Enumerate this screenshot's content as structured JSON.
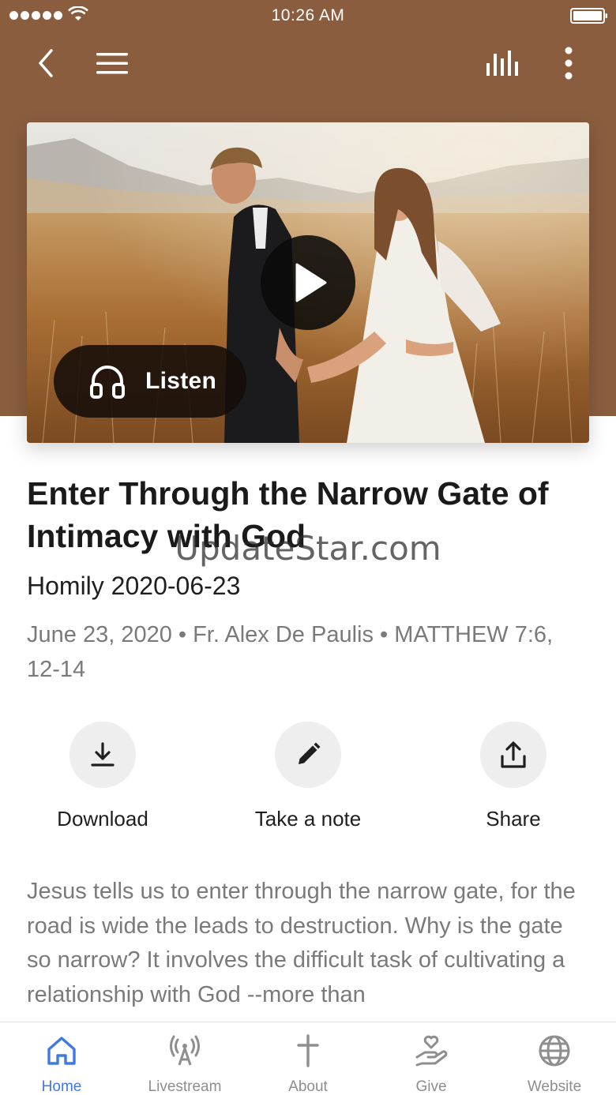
{
  "status_bar": {
    "time": "10:26 AM"
  },
  "nav": {
    "back_icon": "chevron-left-icon",
    "menu_icon": "hamburger-menu-icon",
    "audio_icon": "audio-bars-icon",
    "more_icon": "more-vertical-icon"
  },
  "media": {
    "play_icon": "play-icon",
    "listen_label": "Listen",
    "listen_icon": "headphones-icon"
  },
  "sermon": {
    "title": "Enter Through the Narrow Gate of Intimacy with God",
    "subtitle": "Homily 2020-06-23",
    "meta": "June 23, 2020 • Fr. Alex De Paulis • MATTHEW 7:6, 12-14",
    "description": "Jesus tells us to enter through the narrow gate, for the road is wide the leads to destruction.  Why is the gate so narrow?  It involves the difficult task of cultivating a relationship with God --more than"
  },
  "actions": {
    "download_label": "Download",
    "note_label": "Take a note",
    "share_label": "Share"
  },
  "watermark": "UpdateStar.com",
  "tabs": [
    {
      "label": "Home",
      "icon": "home-icon",
      "active": true
    },
    {
      "label": "Livestream",
      "icon": "broadcast-icon",
      "active": false
    },
    {
      "label": "About",
      "icon": "cross-icon",
      "active": false
    },
    {
      "label": "Give",
      "icon": "giving-hand-icon",
      "active": false
    },
    {
      "label": "Website",
      "icon": "globe-icon",
      "active": false
    }
  ],
  "colors": {
    "header_brown": "#8a5d3f",
    "active_tab": "#3f7ae0",
    "inactive_tab": "#8e8e8e",
    "meta_gray": "#7a7a7a"
  }
}
